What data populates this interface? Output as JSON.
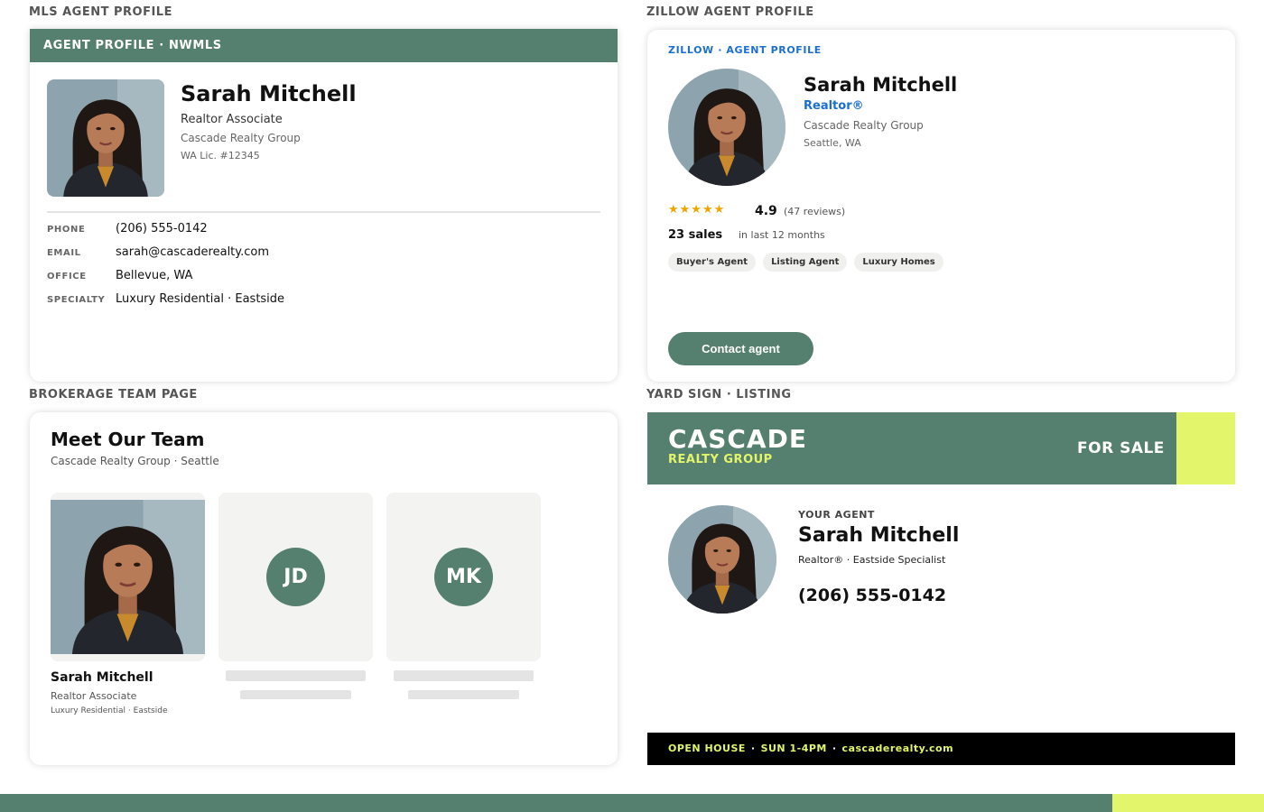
{
  "sections": {
    "mls": "MLS AGENT PROFILE",
    "zillow": "ZILLOW AGENT PROFILE",
    "team": "BROKERAGE TEAM PAGE",
    "yard": "YARD SIGN · LISTING"
  },
  "mls": {
    "bar": "AGENT PROFILE · NWMLS",
    "name": "Sarah Mitchell",
    "title": "Realtor Associate",
    "brokerage": "Cascade Realty Group",
    "license": "WA Lic. #12345",
    "rows": [
      {
        "label": "PHONE",
        "value": "(206) 555-0142"
      },
      {
        "label": "EMAIL",
        "value": "sarah@cascaderealty.com"
      },
      {
        "label": "OFFICE",
        "value": "Bellevue, WA"
      },
      {
        "label": "SPECIALTY",
        "value": "Luxury Residential · Eastside"
      }
    ]
  },
  "zillow": {
    "kicker": "ZILLOW · AGENT PROFILE",
    "name": "Sarah Mitchell",
    "badge": "Realtor®",
    "brokerage": "Cascade Realty Group",
    "city": "Seattle, WA",
    "stars": "★★★★★",
    "rating": "4.9",
    "reviews": "(47 reviews)",
    "sales": "23 sales",
    "sales_sub": "in last 12 months",
    "tags": [
      "Buyer's Agent",
      "Listing Agent",
      "Luxury Homes"
    ],
    "contact": "Contact agent"
  },
  "team": {
    "heading": "Meet Our Team",
    "sub": "Cascade Realty Group · Seattle",
    "featured": {
      "name": "Sarah Mitchell",
      "title": "Realtor Associate",
      "specialty": "Luxury Residential · Eastside"
    },
    "placeholders": [
      "JD",
      "MK"
    ]
  },
  "yard": {
    "brand": "CASCADE",
    "brand_sub": "REALTY GROUP",
    "for_sale": "FOR SALE",
    "kicker": "YOUR AGENT",
    "name": "Sarah Mitchell",
    "role": "Realtor® · Eastside Specialist",
    "phone": "(206) 555-0142",
    "footer": {
      "open_house": "OPEN HOUSE",
      "time": "SUN 1-4PM",
      "site": "cascaderealty.com",
      "separator": "·"
    }
  },
  "colors": {
    "brand_green": "#557f6e",
    "accent_lime": "#e2f56b",
    "zillow_blue": "#1a6fcf",
    "star_gold": "#f0a400"
  }
}
